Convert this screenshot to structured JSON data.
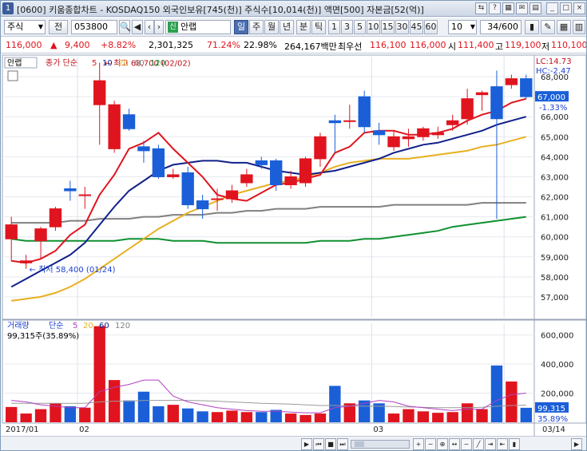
{
  "window": {
    "number": "1",
    "title": "[0600] 키움종합차트 - KOSDAQ150 외국인보유[745(천)] 주식수[10,014(천)] 액면[500] 자본금[52(억)]"
  },
  "toolbar": {
    "market_label": "주식",
    "period_label": "전",
    "code_value": "053800",
    "credit_badge": "신",
    "stock_name": "안랩",
    "tabs": [
      "일",
      "주",
      "월",
      "년",
      "분",
      "틱"
    ],
    "intervals": [
      "1",
      "3",
      "5",
      "10",
      "15",
      "30",
      "45",
      "60"
    ],
    "count_select": "10",
    "page_indicator": "34/600"
  },
  "quote": {
    "price": "116,000",
    "change": "9,400",
    "change_pct": "+8.82%",
    "volume": "2,301,325",
    "vol_ratio": "71.24%",
    "turnover": "22.98%",
    "amount": "264,167백만",
    "ask_label": "최우선",
    "ask": "116,100",
    "bid": "116,000",
    "open_label": "시",
    "open": "111,400",
    "high_label": "고",
    "high": "119,100",
    "low_label": "저",
    "low": "110,100"
  },
  "colors": {
    "up": "#e0141e",
    "down": "#1a5fd8",
    "ma5": "#e0141e",
    "ma10": "#10208a",
    "ma20": "#e8b020",
    "ma60": "#808080",
    "ma120": "#109030",
    "vma5": "#b040c0",
    "vma10": "#9a9a9a"
  },
  "chart_data": [
    {
      "type": "candlestick",
      "legend": {
        "name": "안랩",
        "indicator": "종가 단순",
        "periods": [
          "5",
          "10",
          "20",
          "60",
          "120"
        ]
      },
      "right_labels": {
        "lc": "LC:14.73",
        "hc": "HC:-2.47",
        "last_price": "67,000",
        "last_pct": "-1.33%"
      },
      "annotations": {
        "high": "최고 68,700 (02/02)",
        "low": "최저 58,400 (01/24)"
      },
      "ylim": [
        56000,
        69000
      ],
      "yticks": [
        "57,000",
        "58,000",
        "59,000",
        "60,000",
        "61,000",
        "62,000",
        "63,000",
        "64,000",
        "65,000",
        "66,000",
        "67,000",
        "68,000"
      ],
      "yticks_values": [
        57000,
        58000,
        59000,
        60000,
        61000,
        62000,
        63000,
        64000,
        65000,
        66000,
        67000,
        68000
      ],
      "xticks": [
        {
          "label": "2017/01",
          "index": 0
        },
        {
          "label": "02",
          "index": 5
        },
        {
          "label": "03",
          "index": 25
        },
        {
          "label": "03/14",
          "index": 34
        }
      ],
      "candles": [
        {
          "o": 59900,
          "h": 61000,
          "l": 58800,
          "c": 60600
        },
        {
          "o": 58700,
          "h": 59100,
          "l": 58400,
          "c": 58800
        },
        {
          "o": 59800,
          "h": 60500,
          "l": 58900,
          "c": 60400
        },
        {
          "o": 60500,
          "h": 61500,
          "l": 60300,
          "c": 61400
        },
        {
          "o": 62400,
          "h": 62800,
          "l": 61800,
          "c": 62300
        },
        {
          "o": 62100,
          "h": 62500,
          "l": 61400,
          "c": 62100
        },
        {
          "o": 66600,
          "h": 68700,
          "l": 64600,
          "c": 67800
        },
        {
          "o": 64400,
          "h": 66800,
          "l": 64200,
          "c": 66600
        },
        {
          "o": 66100,
          "h": 66400,
          "l": 65300,
          "c": 65400
        },
        {
          "o": 64500,
          "h": 64800,
          "l": 63700,
          "c": 64300
        },
        {
          "o": 64400,
          "h": 64600,
          "l": 62900,
          "c": 63000
        },
        {
          "o": 63000,
          "h": 63400,
          "l": 62900,
          "c": 63100
        },
        {
          "o": 63200,
          "h": 63500,
          "l": 61400,
          "c": 61600
        },
        {
          "o": 61800,
          "h": 62100,
          "l": 60900,
          "c": 61400
        },
        {
          "o": 61900,
          "h": 62400,
          "l": 61300,
          "c": 61900
        },
        {
          "o": 61900,
          "h": 62600,
          "l": 61700,
          "c": 62300
        },
        {
          "o": 62700,
          "h": 63400,
          "l": 62500,
          "c": 63100
        },
        {
          "o": 63800,
          "h": 64000,
          "l": 63400,
          "c": 63600
        },
        {
          "o": 63800,
          "h": 63900,
          "l": 62300,
          "c": 62600
        },
        {
          "o": 62600,
          "h": 63300,
          "l": 62400,
          "c": 63000
        },
        {
          "o": 62700,
          "h": 64000,
          "l": 62500,
          "c": 63900
        },
        {
          "o": 63900,
          "h": 65200,
          "l": 63500,
          "c": 65000
        },
        {
          "o": 65800,
          "h": 66100,
          "l": 64200,
          "c": 65700
        },
        {
          "o": 65800,
          "h": 66600,
          "l": 65400,
          "c": 65800
        },
        {
          "o": 67000,
          "h": 67300,
          "l": 65200,
          "c": 65500
        },
        {
          "o": 65300,
          "h": 65700,
          "l": 64600,
          "c": 65100
        },
        {
          "o": 64500,
          "h": 65300,
          "l": 64300,
          "c": 65000
        },
        {
          "o": 64900,
          "h": 65400,
          "l": 64500,
          "c": 65000
        },
        {
          "o": 65000,
          "h": 65500,
          "l": 64800,
          "c": 65400
        },
        {
          "o": 65100,
          "h": 65500,
          "l": 64900,
          "c": 65200
        },
        {
          "o": 65600,
          "h": 66100,
          "l": 65300,
          "c": 65800
        },
        {
          "o": 65900,
          "h": 67400,
          "l": 65600,
          "c": 66900
        },
        {
          "o": 67100,
          "h": 67300,
          "l": 66300,
          "c": 67200
        },
        {
          "o": 67500,
          "h": 68300,
          "l": 60900,
          "c": 65900
        },
        {
          "o": 67600,
          "h": 68100,
          "l": 67400,
          "c": 67900
        },
        {
          "o": 67900,
          "h": 68100,
          "l": 66900,
          "c": 67000
        }
      ],
      "ma5": [
        58800,
        58700,
        58900,
        59300,
        60100,
        60600,
        62100,
        63100,
        64400,
        64700,
        65200,
        64400,
        63700,
        63000,
        62100,
        61900,
        61800,
        62200,
        62600,
        62700,
        62900,
        63100,
        64200,
        64500,
        65200,
        65300,
        65300,
        65100,
        65100,
        65200,
        65400,
        65800,
        66100,
        66300,
        66700,
        66900
      ],
      "ma10": [
        57500,
        57900,
        58300,
        58700,
        59100,
        59700,
        60600,
        61500,
        62300,
        62800,
        63300,
        63600,
        63700,
        63800,
        63800,
        63700,
        63700,
        63500,
        63300,
        63200,
        63100,
        63200,
        63300,
        63500,
        63700,
        63900,
        64200,
        64400,
        64600,
        64700,
        64900,
        65100,
        65300,
        65600,
        65800,
        66000
      ],
      "ma20": [
        56800,
        56900,
        57000,
        57200,
        57500,
        57900,
        58400,
        58900,
        59400,
        59900,
        60400,
        60800,
        61200,
        61500,
        61800,
        62100,
        62300,
        62500,
        62700,
        62800,
        63000,
        63200,
        63500,
        63700,
        63800,
        63900,
        63900,
        63900,
        64000,
        64100,
        64200,
        64300,
        64500,
        64600,
        64800,
        65000
      ],
      "ma60": [
        60700,
        60700,
        60700,
        60700,
        60800,
        60800,
        60900,
        60900,
        60900,
        61000,
        61000,
        61100,
        61100,
        61100,
        61200,
        61200,
        61300,
        61300,
        61400,
        61400,
        61400,
        61500,
        61500,
        61500,
        61500,
        61500,
        61600,
        61600,
        61600,
        61600,
        61600,
        61600,
        61700,
        61700,
        61700,
        61700
      ],
      "ma120": [
        59900,
        59800,
        59800,
        59800,
        59800,
        59800,
        59800,
        59800,
        59900,
        59900,
        59900,
        59800,
        59800,
        59800,
        59700,
        59700,
        59700,
        59700,
        59700,
        59700,
        59700,
        59800,
        59800,
        59800,
        59900,
        59900,
        60000,
        60100,
        60200,
        60300,
        60500,
        60600,
        60700,
        60800,
        60900,
        61000
      ]
    },
    {
      "type": "bar",
      "legend": {
        "name": "거래량",
        "indicator": "단순",
        "periods": [
          "5",
          "20",
          "60",
          "120"
        ]
      },
      "current_label": "99,315주(35.89%)",
      "right_labels": {
        "value": "99,315",
        "pct": "35.89%"
      },
      "ylim": [
        0,
        680000
      ],
      "yticks": [
        "200,000",
        "400,000",
        "600,000"
      ],
      "yticks_values": [
        200000,
        400000,
        600000
      ],
      "volumes": [
        105000,
        60000,
        90000,
        130000,
        110000,
        100000,
        660000,
        290000,
        150000,
        210000,
        110000,
        120000,
        95000,
        75000,
        70000,
        80000,
        70000,
        70000,
        85000,
        60000,
        50000,
        60000,
        250000,
        130000,
        150000,
        130000,
        60000,
        90000,
        75000,
        65000,
        70000,
        130000,
        90000,
        390000,
        280000,
        99315
      ],
      "vma5": [
        150000,
        140000,
        120000,
        110000,
        100000,
        100000,
        210000,
        240000,
        260000,
        290000,
        290000,
        180000,
        140000,
        120000,
        100000,
        90000,
        80000,
        75000,
        75000,
        70000,
        65000,
        65000,
        100000,
        110000,
        130000,
        150000,
        140000,
        110000,
        100000,
        90000,
        80000,
        90000,
        90000,
        150000,
        190000,
        200000
      ],
      "vma20": [
        130000,
        130000,
        130000,
        130000,
        130000,
        130000,
        140000,
        145000,
        145000,
        150000,
        150000,
        150000,
        150000,
        148000,
        145000,
        140000,
        135000,
        130000,
        128000,
        125000,
        120000,
        115000,
        115000,
        112000,
        110000,
        110000,
        108000,
        105000,
        103000,
        100000,
        100000,
        100000,
        103000,
        110000,
        115000,
        118000
      ]
    }
  ],
  "bottom": {
    "xlabels": [
      "2017/01",
      "02",
      "03",
      "03/14"
    ]
  }
}
